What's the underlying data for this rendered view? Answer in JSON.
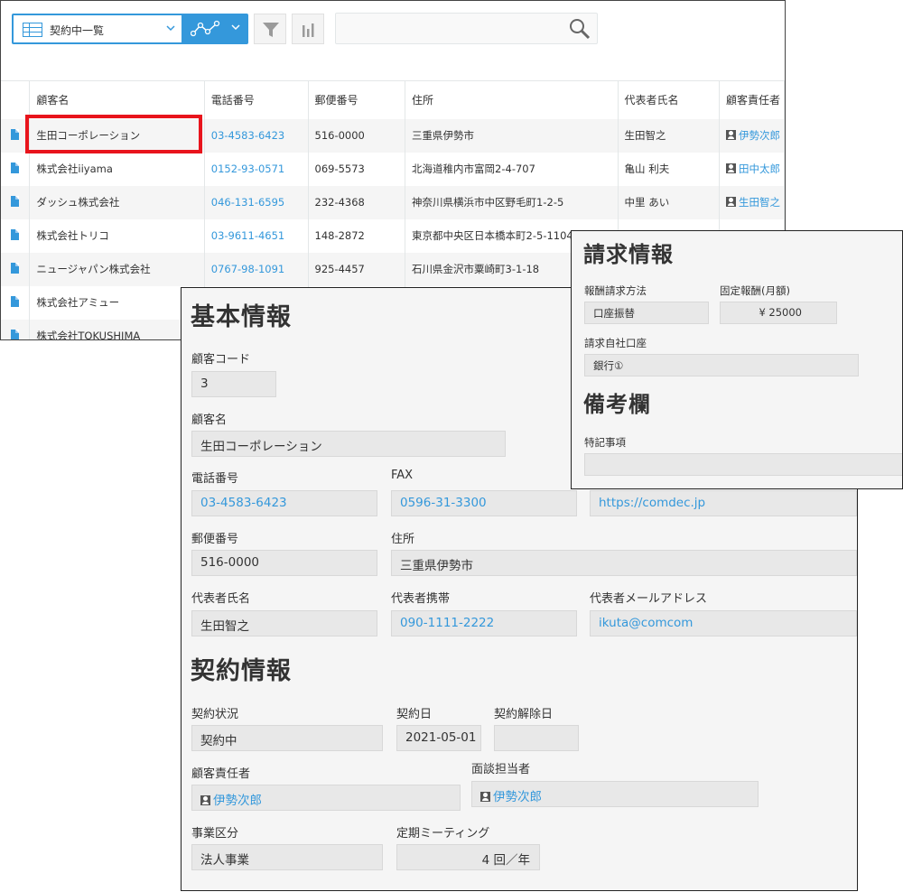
{
  "list": {
    "view_name": "契約中一覧",
    "search_placeholder": "",
    "columns": [
      "顧客名",
      "電話番号",
      "郵便番号",
      "住所",
      "代表者氏名",
      "顧客責任者"
    ],
    "rows": [
      {
        "name": "生田コーポレーション",
        "tel": "03-4583-6423",
        "zip": "516-0000",
        "addr": "三重県伊勢市",
        "rep": "生田智之",
        "mgr": "伊勢次郎"
      },
      {
        "name": "株式会社iiyama",
        "tel": "0152-93-0571",
        "zip": "069-5573",
        "addr": "北海道稚内市富岡2-4-707",
        "rep": "亀山 利夫",
        "mgr": "田中太郎"
      },
      {
        "name": "ダッシュ株式会社",
        "tel": "046-131-6595",
        "zip": "232-4368",
        "addr": "神奈川県横浜市中区野毛町1-2-5",
        "rep": "中里 あい",
        "mgr": "生田智之"
      },
      {
        "name": "株式会社トリコ",
        "tel": "03-9611-4651",
        "zip": "148-2872",
        "addr": "東京都中央区日本橋本町2-5-1104",
        "rep": "",
        "mgr": ""
      },
      {
        "name": "ニュージャパン株式会社",
        "tel": "0767-98-1091",
        "zip": "925-4457",
        "addr": "石川県金沢市粟崎町3-1-18",
        "rep": "",
        "mgr": ""
      },
      {
        "name": "株式会社アミュー",
        "tel": "",
        "zip": "",
        "addr": "",
        "rep": "",
        "mgr": ""
      },
      {
        "name": "株式会社TOKUSHIMA",
        "tel": "",
        "zip": "",
        "addr": "",
        "rep": "",
        "mgr": ""
      }
    ]
  },
  "detail": {
    "basic_title": "基本情報",
    "customer_code_label": "顧客コード",
    "customer_code": "3",
    "customer_name_label": "顧客名",
    "customer_name": "生田コーポレーション",
    "tel_label": "電話番号",
    "tel": "03-4583-6423",
    "fax_label": "FAX",
    "fax": "0596-31-3300",
    "url": "https://comdec.jp",
    "zip_label": "郵便番号",
    "zip": "516-0000",
    "addr_label": "住所",
    "addr": "三重県伊勢市",
    "rep_label": "代表者氏名",
    "rep": "生田智之",
    "rep_mobile_label": "代表者携帯",
    "rep_mobile": "090-1111-2222",
    "rep_email_label": "代表者メールアドレス",
    "rep_email": "ikuta@comcom",
    "contract_title": "契約情報",
    "status_label": "契約状況",
    "status": "契約中",
    "contract_date_label": "契約日",
    "contract_date": "2021-05-01",
    "cancel_date_label": "契約解除日",
    "cancel_date": "",
    "mgr_label": "顧客責任者",
    "mgr": "伊勢次郎",
    "interviewer_label": "面談担当者",
    "interviewer": "伊勢次郎",
    "business_label": "事業区分",
    "business": "法人事業",
    "meeting_label": "定期ミーティング",
    "meeting": "4 回／年"
  },
  "billing": {
    "title": "請求情報",
    "method_label": "報酬請求方法",
    "method": "口座振替",
    "fee_label": "固定報酬(月額)",
    "fee": "¥ 25000",
    "account_label": "請求自社口座",
    "account": "銀行①",
    "notes_title": "備考欄",
    "special_label": "特記事項",
    "special": ""
  }
}
